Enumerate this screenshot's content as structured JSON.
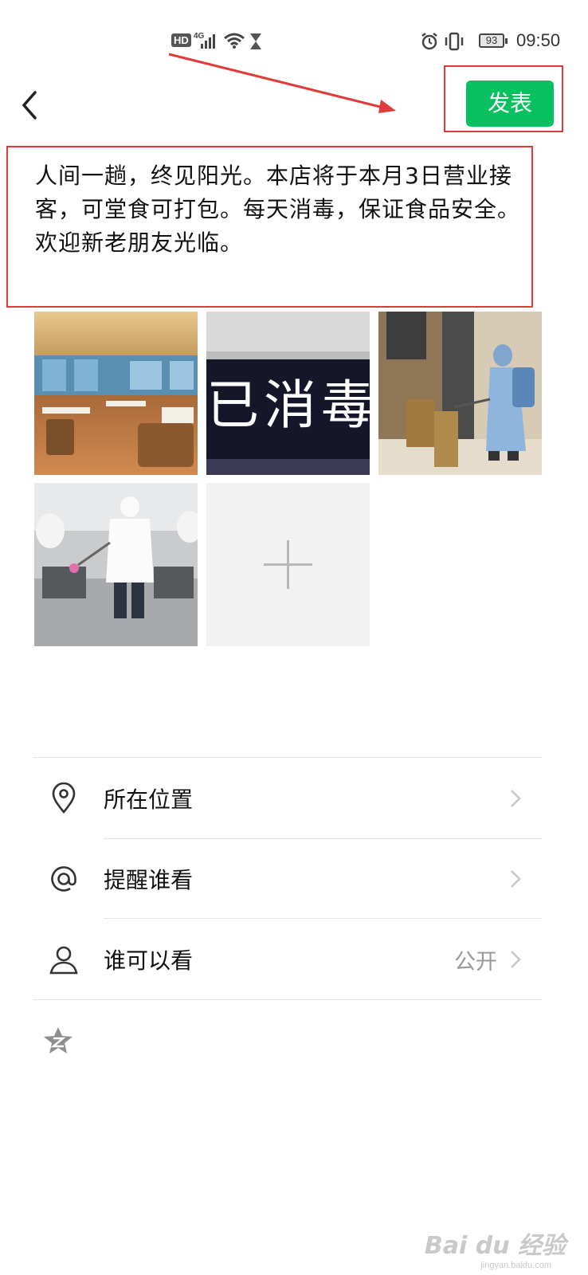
{
  "status_bar": {
    "hd": "HD",
    "network": "4G",
    "battery": "93",
    "time": "09:50",
    "icons": [
      "signal-icon",
      "wifi-icon",
      "hourglass-icon",
      "alarm-icon",
      "vibrate-icon"
    ]
  },
  "nav": {
    "back_icon": "chevron-left-icon",
    "publish_label": "发表",
    "accent_color": "#07c160"
  },
  "post": {
    "text": "人间一趟，终见阳光。本店将于本月3日营业接客，可堂食可打包。每天消毒，保证食品安全。欢迎新老朋友光临。"
  },
  "images": [
    {
      "subject": "restaurant dining room"
    },
    {
      "subject": "sign",
      "visible_text": "已消毒"
    },
    {
      "subject": "worker in protective suit disinfecting a corridor"
    },
    {
      "subject": "worker in white protective suit spraying disinfectant"
    }
  ],
  "add_image": {
    "icon": "plus-icon"
  },
  "options": [
    {
      "label": "所在位置",
      "value": "",
      "icon": "location-pin-icon"
    },
    {
      "label": "提醒谁看",
      "value": "",
      "icon": "at-icon"
    },
    {
      "label": "谁可以看",
      "value": "公开",
      "icon": "person-icon"
    }
  ],
  "qzone": {
    "icon": "qzone-star-icon"
  },
  "watermark": {
    "brand": "Bai du 经验",
    "url": "jingyan.baidu.com"
  },
  "annotation": {
    "color": "#e03a3a"
  }
}
